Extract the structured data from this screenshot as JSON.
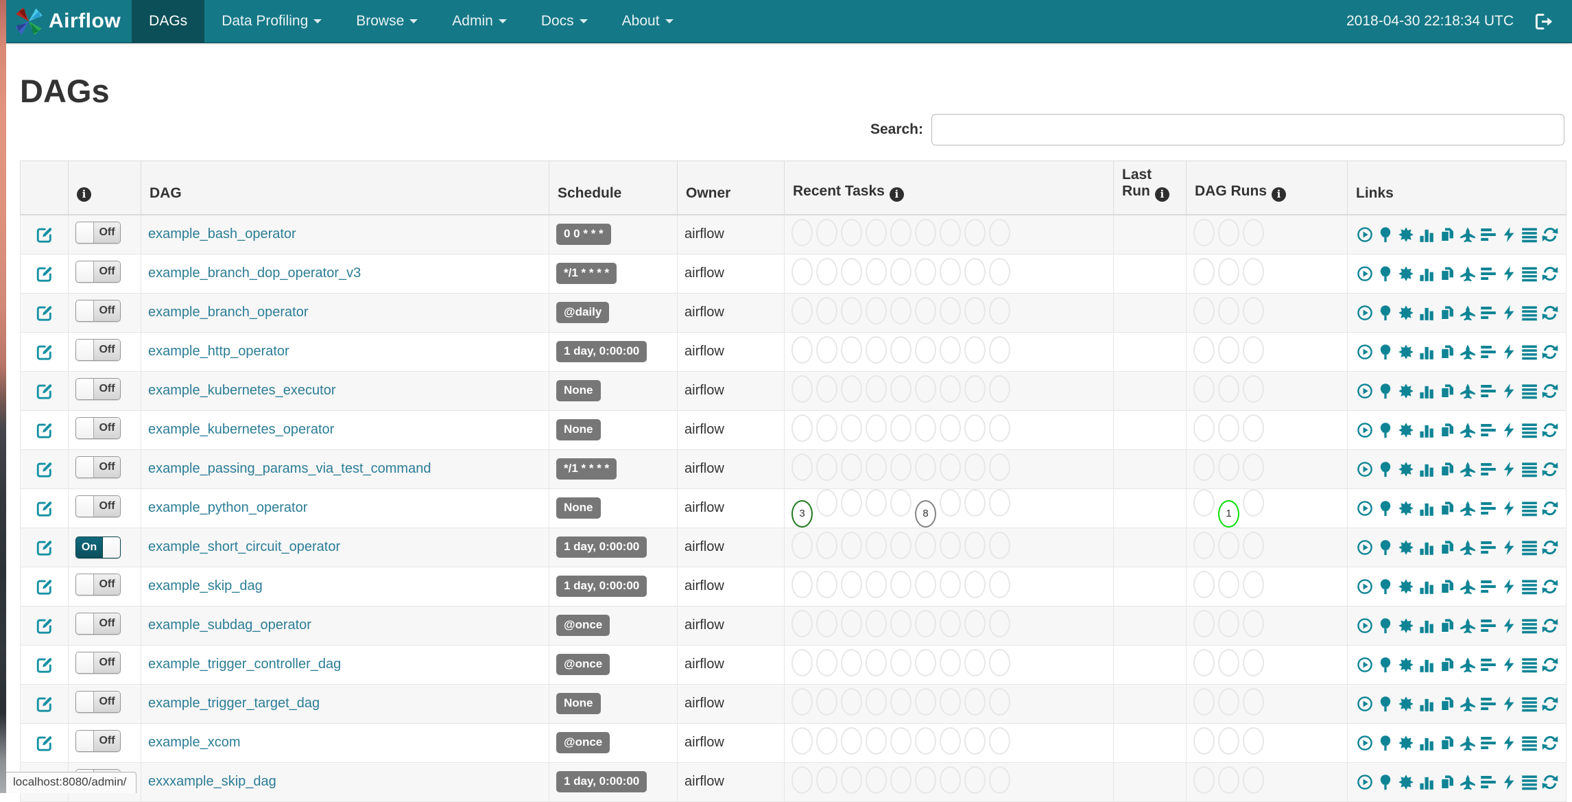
{
  "navbar": {
    "brand": "Airflow",
    "items": [
      {
        "label": "DAGs",
        "active": true,
        "dropdown": false
      },
      {
        "label": "Data Profiling",
        "active": false,
        "dropdown": true
      },
      {
        "label": "Browse",
        "active": false,
        "dropdown": true
      },
      {
        "label": "Admin",
        "active": false,
        "dropdown": true
      },
      {
        "label": "Docs",
        "active": false,
        "dropdown": true
      },
      {
        "label": "About",
        "active": false,
        "dropdown": true
      }
    ],
    "clock": "2018-04-30 22:18:34 UTC",
    "logout_icon": "sign-out-icon"
  },
  "page": {
    "title": "DAGs"
  },
  "search": {
    "label": "Search:",
    "value": "",
    "placeholder": ""
  },
  "table": {
    "headers": {
      "info_icon": "info-icon",
      "dag": "DAG",
      "schedule": "Schedule",
      "owner": "Owner",
      "recent_tasks": "Recent Tasks",
      "last_run": "Last Run",
      "dag_runs": "DAG Runs",
      "links": "Links"
    },
    "recent_tasks_slots": 9,
    "dag_runs_slots": 3,
    "links": [
      "trigger-dag",
      "tree-view",
      "graph-view",
      "task-duration",
      "task-tries",
      "landing-times",
      "gantt-view",
      "code-view",
      "logs",
      "refresh"
    ],
    "toggle_labels": {
      "on": "On",
      "off": "Off"
    },
    "rows": [
      {
        "dag": "example_bash_operator",
        "schedule": "0 0 * * *",
        "owner": "airflow",
        "toggle": "Off",
        "last_run": "",
        "recent_tasks": [],
        "dag_runs": []
      },
      {
        "dag": "example_branch_dop_operator_v3",
        "schedule": "*/1 * * * *",
        "owner": "airflow",
        "toggle": "Off",
        "last_run": "",
        "recent_tasks": [],
        "dag_runs": []
      },
      {
        "dag": "example_branch_operator",
        "schedule": "@daily",
        "owner": "airflow",
        "toggle": "Off",
        "last_run": "",
        "recent_tasks": [],
        "dag_runs": []
      },
      {
        "dag": "example_http_operator",
        "schedule": "1 day, 0:00:00",
        "owner": "airflow",
        "toggle": "Off",
        "last_run": "",
        "recent_tasks": [],
        "dag_runs": []
      },
      {
        "dag": "example_kubernetes_executor",
        "schedule": "None",
        "owner": "airflow",
        "toggle": "Off",
        "last_run": "",
        "recent_tasks": [],
        "dag_runs": []
      },
      {
        "dag": "example_kubernetes_operator",
        "schedule": "None",
        "owner": "airflow",
        "toggle": "Off",
        "last_run": "",
        "recent_tasks": [],
        "dag_runs": []
      },
      {
        "dag": "example_passing_params_via_test_command",
        "schedule": "*/1 * * * *",
        "owner": "airflow",
        "toggle": "Off",
        "last_run": "",
        "recent_tasks": [],
        "dag_runs": []
      },
      {
        "dag": "example_python_operator",
        "schedule": "None",
        "owner": "airflow",
        "toggle": "Off",
        "last_run": "",
        "recent_tasks": [
          {
            "slot": 0,
            "count": "3",
            "state": "success"
          },
          {
            "slot": 5,
            "count": "8",
            "state": "queued"
          }
        ],
        "dag_runs": [
          {
            "slot": 1,
            "count": "1",
            "state": "running"
          }
        ]
      },
      {
        "dag": "example_short_circuit_operator",
        "schedule": "1 day, 0:00:00",
        "owner": "airflow",
        "toggle": "On",
        "last_run": "",
        "recent_tasks": [],
        "dag_runs": []
      },
      {
        "dag": "example_skip_dag",
        "schedule": "1 day, 0:00:00",
        "owner": "airflow",
        "toggle": "Off",
        "last_run": "",
        "recent_tasks": [],
        "dag_runs": []
      },
      {
        "dag": "example_subdag_operator",
        "schedule": "@once",
        "owner": "airflow",
        "toggle": "Off",
        "last_run": "",
        "recent_tasks": [],
        "dag_runs": []
      },
      {
        "dag": "example_trigger_controller_dag",
        "schedule": "@once",
        "owner": "airflow",
        "toggle": "Off",
        "last_run": "",
        "recent_tasks": [],
        "dag_runs": []
      },
      {
        "dag": "example_trigger_target_dag",
        "schedule": "None",
        "owner": "airflow",
        "toggle": "Off",
        "last_run": "",
        "recent_tasks": [],
        "dag_runs": []
      },
      {
        "dag": "example_xcom",
        "schedule": "@once",
        "owner": "airflow",
        "toggle": "Off",
        "last_run": "",
        "recent_tasks": [],
        "dag_runs": []
      },
      {
        "dag": "exxxample_skip_dag",
        "schedule": "1 day, 0:00:00",
        "owner": "airflow",
        "toggle": "Off",
        "last_run": "",
        "recent_tasks": [],
        "dag_runs": []
      }
    ]
  },
  "status_bar": {
    "text": "localhost:8080/admin/"
  },
  "colors": {
    "navbar_bg": "#157887",
    "navbar_active_bg": "#0c4f58",
    "dag_link": "#2c7d96",
    "icon_teal": "#0f8495",
    "schedule_badge_bg": "#777777",
    "toggle_on_bg": "#0d5d6e",
    "circle_empty_border": "#e7e7e7",
    "circle_success": "#1f7a1f",
    "circle_running": "#0ade0a",
    "circle_queued": "#848484",
    "header_bg": "#f5f5f5",
    "row_stripe": "#f7f7f7"
  }
}
